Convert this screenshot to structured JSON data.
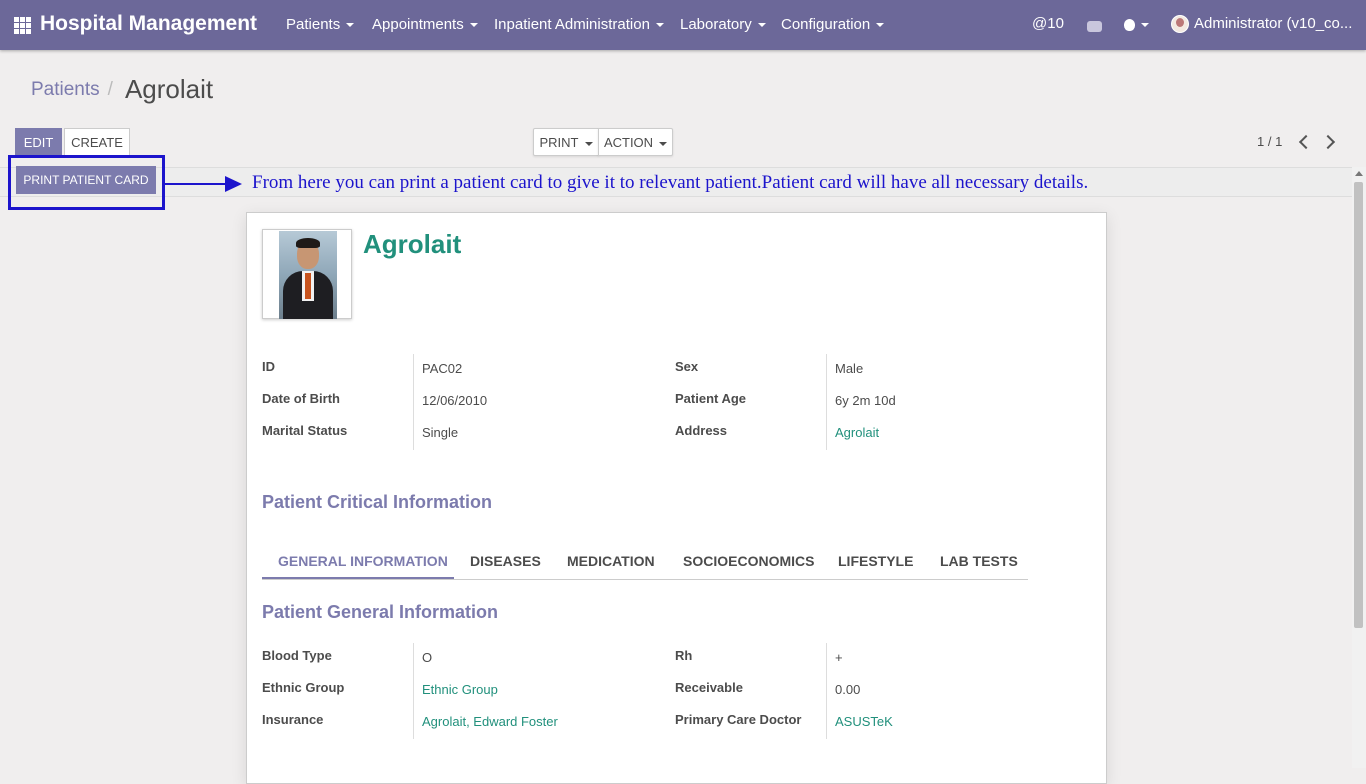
{
  "navbar": {
    "brand": "Hospital Management",
    "menus": [
      "Patients",
      "Appointments",
      "Inpatient Administration",
      "Laboratory",
      "Configuration"
    ],
    "mentions": "@10",
    "user": "Administrator (v10_co..."
  },
  "breadcrumb": {
    "parent": "Patients",
    "separator": "/",
    "current": "Agrolait"
  },
  "buttons": {
    "edit": "EDIT",
    "create": "CREATE",
    "print": "PRINT",
    "action": "ACTION",
    "print_patient_card": "PRINT PATIENT CARD"
  },
  "pager": "1 / 1",
  "annotation": "From here you can print a patient card to give it to relevant patient.Patient card will have all necessary details.",
  "patient": {
    "name": "Agrolait",
    "fields_left": [
      {
        "label": "ID",
        "value": "PAC02",
        "link": false
      },
      {
        "label": "Date of Birth",
        "value": "12/06/2010",
        "link": false
      },
      {
        "label": "Marital Status",
        "value": "Single",
        "link": false
      }
    ],
    "fields_right": [
      {
        "label": "Sex",
        "value": "Male",
        "link": false
      },
      {
        "label": "Patient Age",
        "value": "6y 2m 10d",
        "link": false
      },
      {
        "label": "Address",
        "value": "Agrolait",
        "link": true
      }
    ]
  },
  "critical_title": "Patient Critical Information",
  "tabs": [
    "GENERAL INFORMATION",
    "DISEASES",
    "MEDICATION",
    "SOCIOECONOMICS",
    "LIFESTYLE",
    "LAB TESTS"
  ],
  "general": {
    "title": "Patient General Information",
    "fields_left": [
      {
        "label": "Blood Type",
        "value": "O",
        "link": false
      },
      {
        "label": "Ethnic Group",
        "value": "Ethnic Group",
        "link": true
      },
      {
        "label": "Insurance",
        "value": "Agrolait, Edward Foster",
        "link": true
      }
    ],
    "fields_right": [
      {
        "label": "Rh",
        "value": "+",
        "link": false
      },
      {
        "label": "Receivable",
        "value": "0.00",
        "link": false
      },
      {
        "label": "Primary Care Doctor",
        "value": "ASUSTeK",
        "link": true
      }
    ]
  },
  "colors": {
    "navbar": "#6c6899",
    "primary": "#7c7bad",
    "link": "#21907c",
    "annotation": "#1c14cc"
  }
}
